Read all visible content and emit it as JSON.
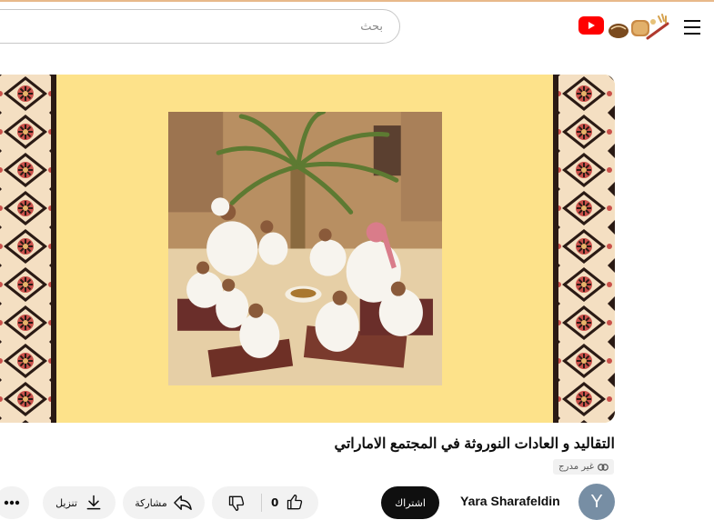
{
  "header": {
    "search_placeholder": "بحث"
  },
  "video": {
    "title": "التقاليد و العادات النوروثة في المجتمع الاماراتي",
    "visibility_badge": "غير مدرج"
  },
  "channel": {
    "avatar_letter": "Y",
    "name": "Yara Sharafeldin",
    "subscribe_label": "اشتراك"
  },
  "actions": {
    "like_count": "0",
    "share_label": "مشاركة",
    "download_label": "تنزيل"
  },
  "colors": {
    "player_background": "#fde28a",
    "youtube_red": "#ff0000",
    "subscribe_bg": "#0f0f0f",
    "avatar_bg": "#778ea4"
  }
}
